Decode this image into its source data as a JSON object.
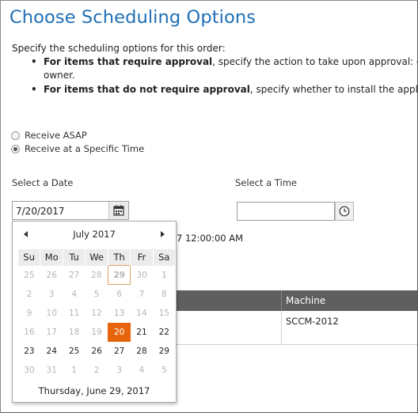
{
  "page": {
    "title": "Choose Scheduling Options",
    "intro": "Specify the scheduling options for this order:",
    "bullets": [
      {
        "bold": "For items that require approval",
        "text": ", specify the action to take upon approval: deliv",
        "cont": "owner."
      },
      {
        "bold": "For items that do not require approval",
        "text": ", specify whether to install the applicatio",
        "cont": ""
      }
    ]
  },
  "schedule": {
    "options": [
      {
        "label": "Receive ASAP",
        "checked": false
      },
      {
        "label": "Receive at a Specific Time",
        "checked": true
      }
    ],
    "date_label": "Select a Date",
    "time_label": "Select a Time",
    "date_value": "7/20/2017",
    "time_value": "",
    "behind_text": "7 12:00:00 AM"
  },
  "grid": {
    "machine_header": "Machine",
    "rows": [
      {
        "machine": "SCCM-2012"
      }
    ]
  },
  "calendar": {
    "month_label": "July 2017",
    "weekdays": [
      "Su",
      "Mo",
      "Tu",
      "We",
      "Th",
      "Fr",
      "Sa"
    ],
    "weeks": [
      [
        {
          "d": "25",
          "s": "other"
        },
        {
          "d": "26",
          "s": "other"
        },
        {
          "d": "27",
          "s": "other"
        },
        {
          "d": "28",
          "s": "other"
        },
        {
          "d": "29",
          "s": "today"
        },
        {
          "d": "30",
          "s": "other"
        },
        {
          "d": "1",
          "s": "other"
        }
      ],
      [
        {
          "d": "2",
          "s": "other"
        },
        {
          "d": "3",
          "s": "other"
        },
        {
          "d": "4",
          "s": "other"
        },
        {
          "d": "5",
          "s": "other"
        },
        {
          "d": "6",
          "s": "other"
        },
        {
          "d": "7",
          "s": "other"
        },
        {
          "d": "8",
          "s": "other"
        }
      ],
      [
        {
          "d": "9",
          "s": "other"
        },
        {
          "d": "10",
          "s": "other"
        },
        {
          "d": "11",
          "s": "other"
        },
        {
          "d": "12",
          "s": "other"
        },
        {
          "d": "13",
          "s": "other"
        },
        {
          "d": "14",
          "s": "other"
        },
        {
          "d": "15",
          "s": "other"
        }
      ],
      [
        {
          "d": "16",
          "s": "other"
        },
        {
          "d": "17",
          "s": "other"
        },
        {
          "d": "18",
          "s": "other"
        },
        {
          "d": "19",
          "s": "other"
        },
        {
          "d": "20",
          "s": "selected"
        },
        {
          "d": "21",
          "s": ""
        },
        {
          "d": "22",
          "s": ""
        }
      ],
      [
        {
          "d": "23",
          "s": ""
        },
        {
          "d": "24",
          "s": ""
        },
        {
          "d": "25",
          "s": ""
        },
        {
          "d": "26",
          "s": ""
        },
        {
          "d": "27",
          "s": ""
        },
        {
          "d": "28",
          "s": ""
        },
        {
          "d": "29",
          "s": ""
        }
      ],
      [
        {
          "d": "30",
          "s": "other"
        },
        {
          "d": "31",
          "s": "other"
        },
        {
          "d": "1",
          "s": "other"
        },
        {
          "d": "2",
          "s": "other"
        },
        {
          "d": "3",
          "s": "other"
        },
        {
          "d": "4",
          "s": "other"
        },
        {
          "d": "5",
          "s": "other"
        }
      ]
    ],
    "footer": "Thursday, June 29, 2017"
  },
  "icons": {
    "calendar": "calendar-icon",
    "clock": "clock-icon",
    "prev": "chevron-left-icon",
    "next": "chevron-right-icon"
  },
  "colors": {
    "title": "#1f6fb6",
    "selected_day": "#e8640c",
    "grid_header": "#5f5f5f"
  }
}
